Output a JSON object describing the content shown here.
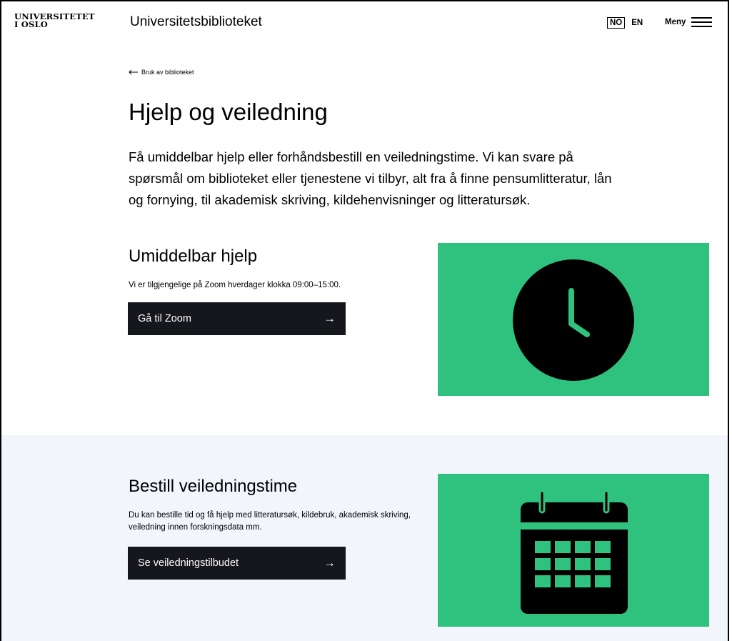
{
  "header": {
    "logo_line1": "UNIVERSITETET",
    "logo_line2": "I OSLO",
    "site_title": "Universitetsbiblioteket",
    "lang_no": "NO",
    "lang_en": "EN",
    "menu_label": "Meny"
  },
  "breadcrumb": {
    "label": "Bruk av biblioteket"
  },
  "page": {
    "title": "Hjelp og veiledning",
    "lead": "Få umiddelbar hjelp eller forhåndsbestill en veiledningstime. Vi kan svare på spørsmål om biblioteket eller tjenestene vi tilbyr, alt fra å finne pensumlitteratur, lån og fornying, til akademisk skriving, kildehenvisninger og litteratursøk."
  },
  "immediate": {
    "heading": "Umiddelbar hjelp",
    "text": "Vi er tilgjengelige på Zoom hverdager klokka 09:00–15:00.",
    "button_label": "Gå til Zoom",
    "icon": "clock-icon"
  },
  "booking": {
    "heading": "Bestill veiledningstime",
    "text": "Du kan bestille tid og få hjelp med litteratursøk, kildebruk, akademisk skriving, veiledning innen forskningsdata mm.",
    "button_label": "Se veiledningstilbudet",
    "icon": "calendar-icon"
  },
  "colors": {
    "accent_green": "#2ec27e",
    "button_bg": "#16161d",
    "band_bg": "#f3f5fc"
  }
}
